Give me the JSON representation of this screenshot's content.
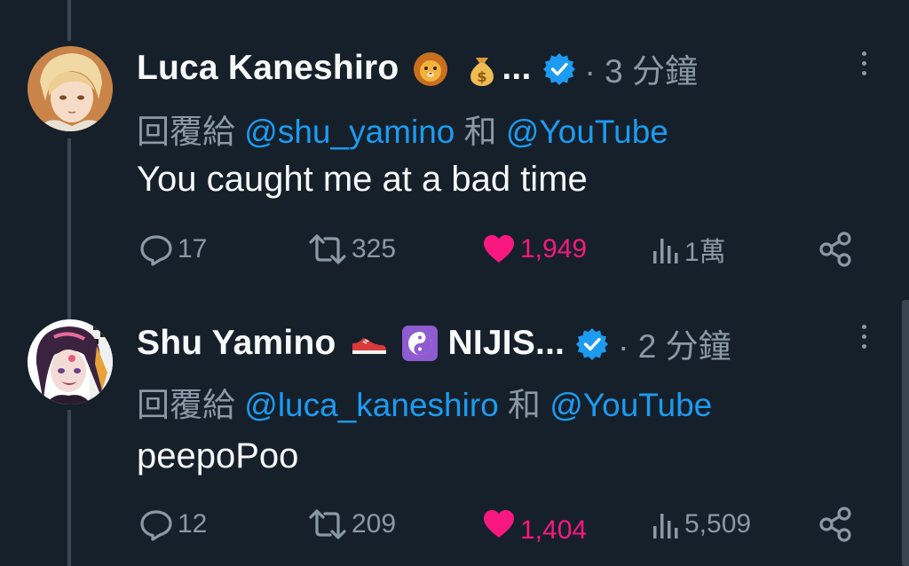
{
  "tweets": [
    {
      "display_name": "Luca Kaneshiro",
      "name_emojis": [
        "lion-face",
        "money-bag"
      ],
      "truncation": "...",
      "verified": true,
      "time": "· 3 分鐘",
      "reply_prefix": "回覆給 ",
      "reply_to_1": "@shu_yamino",
      "reply_joiner": " 和 ",
      "reply_to_2": "@YouTube",
      "text": "You caught me at a bad time",
      "stats": {
        "replies": "17",
        "retweets": "325",
        "likes": "1,949",
        "views": "1萬"
      },
      "liked": true
    },
    {
      "display_name": "Shu Yamino",
      "name_emojis": [
        "sneaker",
        "yin-yang"
      ],
      "name_suffix": "NIJIS",
      "truncation": "...",
      "verified": true,
      "time": "· 2 分鐘",
      "reply_prefix": "回覆給 ",
      "reply_to_1": "@luca_kaneshiro",
      "reply_joiner": " 和 ",
      "reply_to_2": "@YouTube",
      "text": "peepoPoo",
      "stats": {
        "replies": "12",
        "retweets": "209",
        "likes": "1,404",
        "views": "5,509"
      },
      "liked": true
    }
  ],
  "colors": {
    "background": "#15202b",
    "primary_text": "#f7f9f9",
    "secondary_text": "#8b98a5",
    "link": "#1d9bf0",
    "like": "#f91880",
    "verified": "#1d9bf0"
  }
}
